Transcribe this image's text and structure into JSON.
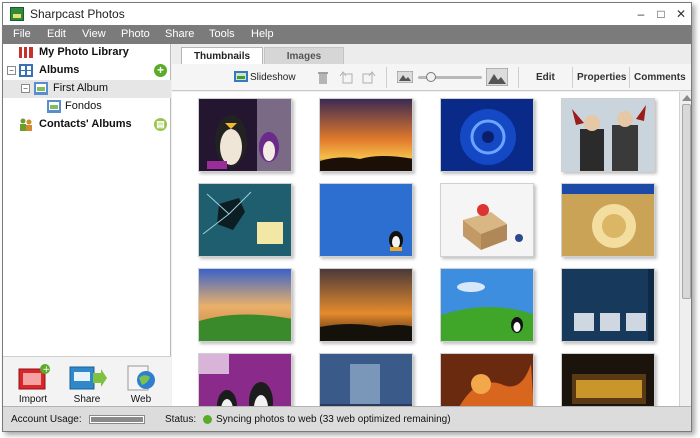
{
  "window": {
    "title": "Sharpcast Photos"
  },
  "menu": [
    "File",
    "Edit",
    "View",
    "Photo",
    "Share",
    "Tools",
    "Help"
  ],
  "sidebar": {
    "library": "My Photo Library",
    "albums": "Albums",
    "first_album": "First Album",
    "fondos": "Fondos",
    "contacts": "Contacts' Albums",
    "buttons": {
      "import": "Import",
      "share": "Share",
      "web": "Web"
    }
  },
  "tabs": {
    "thumbnails": "Thumbnails",
    "images": "Images"
  },
  "toolbar": {
    "slideshow": "Slideshow",
    "edit": "Edit",
    "properties": "Properties",
    "comments": "Comments",
    "zoom_level": 0.15
  },
  "thumbnails": [
    {
      "name": "thumb-penguin-cartoon"
    },
    {
      "name": "thumb-sunset-orange"
    },
    {
      "name": "thumb-blue-swirl"
    },
    {
      "name": "thumb-anime-characters"
    },
    {
      "name": "thumb-broken-screen"
    },
    {
      "name": "thumb-blue-desktop"
    },
    {
      "name": "thumb-softonic-gift"
    },
    {
      "name": "thumb-softonic-gold"
    },
    {
      "name": "thumb-green-hill-sky"
    },
    {
      "name": "thumb-dusk-landscape"
    },
    {
      "name": "thumb-bliss-hill"
    },
    {
      "name": "thumb-dark-desktop"
    },
    {
      "name": "thumb-purple-penguins"
    },
    {
      "name": "thumb-fantasy-scene"
    },
    {
      "name": "thumb-fire-creature"
    },
    {
      "name": "thumb-warcraft"
    }
  ],
  "status": {
    "usage_label": "Account Usage:",
    "status_label": "Status:",
    "message": "Syncing photos to web (33 web optimized remaining)",
    "accent": "#5bab2a"
  }
}
